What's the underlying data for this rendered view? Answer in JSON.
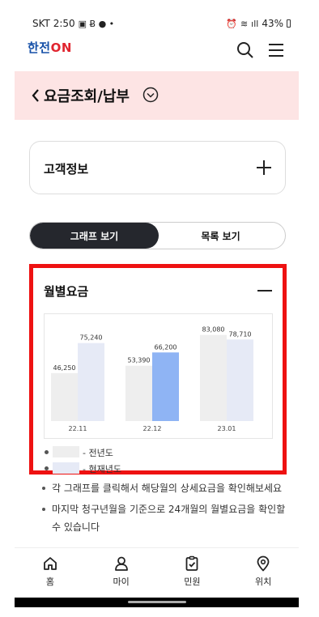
{
  "status_bar": {
    "carrier_time": "SKT 2:50",
    "battery": "43%"
  },
  "header": {
    "logo_text": "한전",
    "logo_on": "ON"
  },
  "title_bar": {
    "title": "요금조회/납부"
  },
  "customer_info": {
    "label": "고객정보"
  },
  "view_toggle": {
    "graph_label": "그래프 보기",
    "list_label": "목록 보기"
  },
  "monthly": {
    "title": "월별요금"
  },
  "chart_data": {
    "type": "bar",
    "categories": [
      "22.11",
      "22.12",
      "23.01"
    ],
    "series": [
      {
        "name": "전년도",
        "values": [
          46250,
          53390,
          83080
        ],
        "color": "#eeeeee"
      },
      {
        "name": "현재년도",
        "values": [
          75240,
          66200,
          78710
        ],
        "color": "#e6eaf6",
        "highlight_color": "#8fb4f4"
      }
    ],
    "value_labels": [
      [
        "46,250",
        "53,390",
        "83,080"
      ],
      [
        "75,240",
        "66,200",
        "78,710"
      ]
    ],
    "highlight_index": 1,
    "ylim": [
      0,
      100000
    ],
    "grid": false
  },
  "legend": [
    {
      "text": "- 전년도",
      "color": "#eeeeee"
    },
    {
      "text": "- 현재년도",
      "color": "#e6eaf6"
    }
  ],
  "notes": [
    "각 그래프를 클릭해서 해당월의 상세요금을 확인해보세요",
    "마지막 청구년월을 기준으로 24개월의 월별요금을 확인할 수 있습니다"
  ],
  "bottom_nav": [
    {
      "label": "홈",
      "icon": "home-icon"
    },
    {
      "label": "마이",
      "icon": "user-icon"
    },
    {
      "label": "민원",
      "icon": "clipboard-check-icon"
    },
    {
      "label": "위치",
      "icon": "location-pin-icon"
    }
  ]
}
